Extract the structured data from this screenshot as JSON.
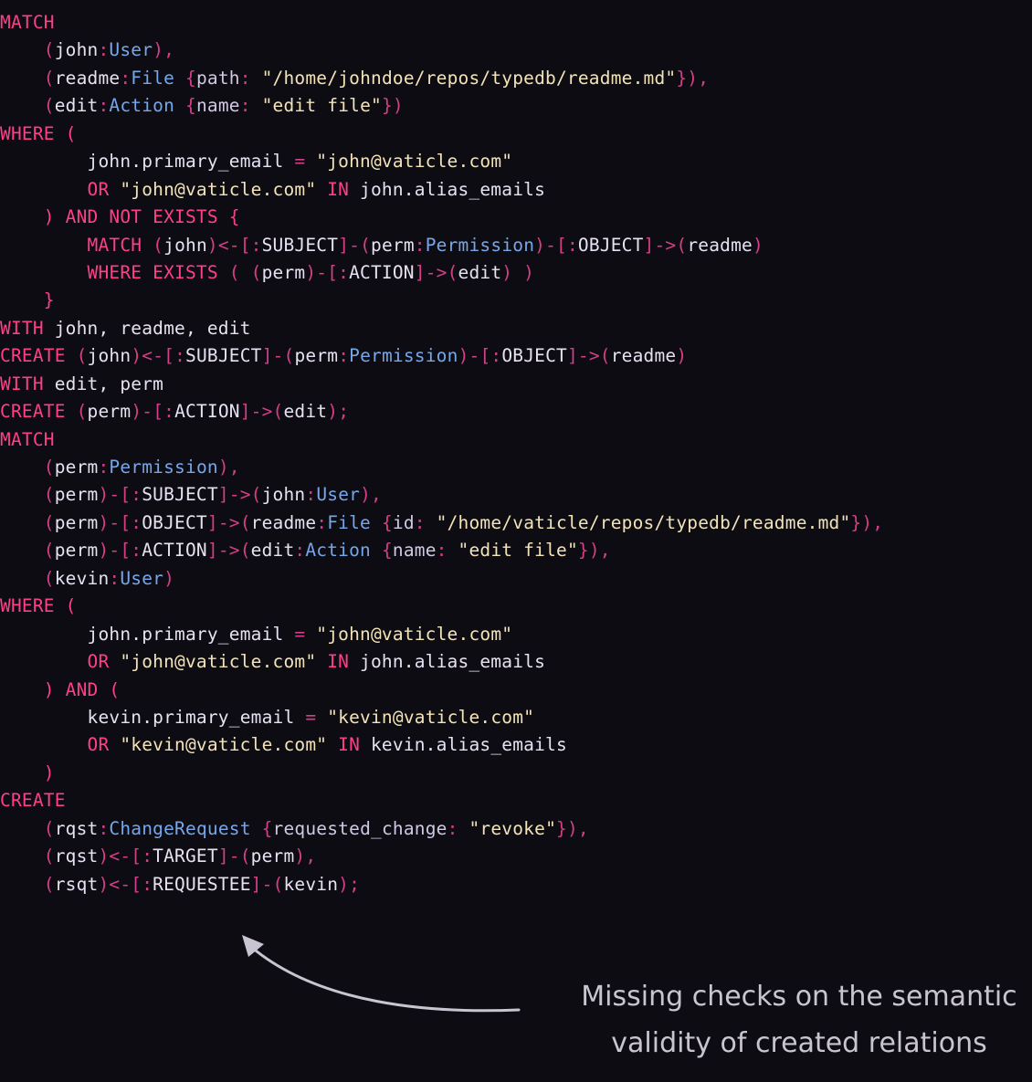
{
  "code_lines": [
    [
      {
        "t": "MATCH",
        "c": "kw"
      }
    ],
    [
      {
        "t": "    (",
        "c": "pu"
      },
      {
        "t": "john",
        "c": "va"
      },
      {
        "t": ":",
        "c": "pu"
      },
      {
        "t": "User",
        "c": "ty"
      },
      {
        "t": "),",
        "c": "pu"
      }
    ],
    [
      {
        "t": "    (",
        "c": "pu"
      },
      {
        "t": "readme",
        "c": "va"
      },
      {
        "t": ":",
        "c": "pu"
      },
      {
        "t": "File",
        "c": "ty"
      },
      {
        "t": " {",
        "c": "pu"
      },
      {
        "t": "path",
        "c": "fl"
      },
      {
        "t": ": ",
        "c": "pu"
      },
      {
        "t": "\"/home/johndoe/repos/typedb/readme.md\"",
        "c": "st"
      },
      {
        "t": "}),",
        "c": "pu"
      }
    ],
    [
      {
        "t": "    (",
        "c": "pu"
      },
      {
        "t": "edit",
        "c": "va"
      },
      {
        "t": ":",
        "c": "pu"
      },
      {
        "t": "Action",
        "c": "ty"
      },
      {
        "t": " {",
        "c": "pu"
      },
      {
        "t": "name",
        "c": "fl"
      },
      {
        "t": ": ",
        "c": "pu"
      },
      {
        "t": "\"edit file\"",
        "c": "st"
      },
      {
        "t": "})",
        "c": "pu"
      }
    ],
    [
      {
        "t": "WHERE (",
        "c": "kw"
      }
    ],
    [
      {
        "t": "        ",
        "c": "va"
      },
      {
        "t": "john.primary_email",
        "c": "va"
      },
      {
        "t": " = ",
        "c": "pu"
      },
      {
        "t": "\"john@vaticle.com\"",
        "c": "st"
      }
    ],
    [
      {
        "t": "        OR ",
        "c": "kw"
      },
      {
        "t": "\"john@vaticle.com\"",
        "c": "st"
      },
      {
        "t": " IN ",
        "c": "kw"
      },
      {
        "t": "john.alias_emails",
        "c": "va"
      }
    ],
    [
      {
        "t": "    ) AND NOT EXISTS {",
        "c": "kw"
      }
    ],
    [
      {
        "t": "        MATCH ",
        "c": "kw"
      },
      {
        "t": "(",
        "c": "pu"
      },
      {
        "t": "john",
        "c": "va"
      },
      {
        "t": ")<-[:",
        "c": "pu"
      },
      {
        "t": "SUBJECT",
        "c": "va"
      },
      {
        "t": "]-(",
        "c": "pu"
      },
      {
        "t": "perm",
        "c": "va"
      },
      {
        "t": ":",
        "c": "pu"
      },
      {
        "t": "Permission",
        "c": "ty"
      },
      {
        "t": ")-[:",
        "c": "pu"
      },
      {
        "t": "OBJECT",
        "c": "va"
      },
      {
        "t": "]->(",
        "c": "pu"
      },
      {
        "t": "readme",
        "c": "va"
      },
      {
        "t": ")",
        "c": "pu"
      }
    ],
    [
      {
        "t": "        WHERE EXISTS ",
        "c": "kw"
      },
      {
        "t": "( (",
        "c": "pu"
      },
      {
        "t": "perm",
        "c": "va"
      },
      {
        "t": ")-[:",
        "c": "pu"
      },
      {
        "t": "ACTION",
        "c": "va"
      },
      {
        "t": "]->(",
        "c": "pu"
      },
      {
        "t": "edit",
        "c": "va"
      },
      {
        "t": ") )",
        "c": "pu"
      }
    ],
    [
      {
        "t": "    }",
        "c": "kw"
      }
    ],
    [
      {
        "t": "WITH ",
        "c": "kw"
      },
      {
        "t": "john, readme, edit",
        "c": "va"
      }
    ],
    [
      {
        "t": "CREATE ",
        "c": "kw"
      },
      {
        "t": "(",
        "c": "pu"
      },
      {
        "t": "john",
        "c": "va"
      },
      {
        "t": ")<-[:",
        "c": "pu"
      },
      {
        "t": "SUBJECT",
        "c": "va"
      },
      {
        "t": "]-(",
        "c": "pu"
      },
      {
        "t": "perm",
        "c": "va"
      },
      {
        "t": ":",
        "c": "pu"
      },
      {
        "t": "Permission",
        "c": "ty"
      },
      {
        "t": ")-[:",
        "c": "pu"
      },
      {
        "t": "OBJECT",
        "c": "va"
      },
      {
        "t": "]->(",
        "c": "pu"
      },
      {
        "t": "readme",
        "c": "va"
      },
      {
        "t": ")",
        "c": "pu"
      }
    ],
    [
      {
        "t": "WITH ",
        "c": "kw"
      },
      {
        "t": "edit, perm",
        "c": "va"
      }
    ],
    [
      {
        "t": "CREATE ",
        "c": "kw"
      },
      {
        "t": "(",
        "c": "pu"
      },
      {
        "t": "perm",
        "c": "va"
      },
      {
        "t": ")-[:",
        "c": "pu"
      },
      {
        "t": "ACTION",
        "c": "va"
      },
      {
        "t": "]->(",
        "c": "pu"
      },
      {
        "t": "edit",
        "c": "va"
      },
      {
        "t": ");",
        "c": "pu"
      }
    ],
    [
      {
        "t": "MATCH",
        "c": "kw"
      }
    ],
    [
      {
        "t": "    (",
        "c": "pu"
      },
      {
        "t": "perm",
        "c": "va"
      },
      {
        "t": ":",
        "c": "pu"
      },
      {
        "t": "Permission",
        "c": "ty"
      },
      {
        "t": "),",
        "c": "pu"
      }
    ],
    [
      {
        "t": "    (",
        "c": "pu"
      },
      {
        "t": "perm",
        "c": "va"
      },
      {
        "t": ")-[:",
        "c": "pu"
      },
      {
        "t": "SUBJECT",
        "c": "va"
      },
      {
        "t": "]->(",
        "c": "pu"
      },
      {
        "t": "john",
        "c": "va"
      },
      {
        "t": ":",
        "c": "pu"
      },
      {
        "t": "User",
        "c": "ty"
      },
      {
        "t": "),",
        "c": "pu"
      }
    ],
    [
      {
        "t": "    (",
        "c": "pu"
      },
      {
        "t": "perm",
        "c": "va"
      },
      {
        "t": ")-[:",
        "c": "pu"
      },
      {
        "t": "OBJECT",
        "c": "va"
      },
      {
        "t": "]->(",
        "c": "pu"
      },
      {
        "t": "readme",
        "c": "va"
      },
      {
        "t": ":",
        "c": "pu"
      },
      {
        "t": "File",
        "c": "ty"
      },
      {
        "t": " {",
        "c": "pu"
      },
      {
        "t": "id",
        "c": "fl"
      },
      {
        "t": ": ",
        "c": "pu"
      },
      {
        "t": "\"/home/vaticle/repos/typedb/readme.md\"",
        "c": "st"
      },
      {
        "t": "}),",
        "c": "pu"
      }
    ],
    [
      {
        "t": "    (",
        "c": "pu"
      },
      {
        "t": "perm",
        "c": "va"
      },
      {
        "t": ")-[:",
        "c": "pu"
      },
      {
        "t": "ACTION",
        "c": "va"
      },
      {
        "t": "]->(",
        "c": "pu"
      },
      {
        "t": "edit",
        "c": "va"
      },
      {
        "t": ":",
        "c": "pu"
      },
      {
        "t": "Action",
        "c": "ty"
      },
      {
        "t": " {",
        "c": "pu"
      },
      {
        "t": "name",
        "c": "fl"
      },
      {
        "t": ": ",
        "c": "pu"
      },
      {
        "t": "\"edit file\"",
        "c": "st"
      },
      {
        "t": "}),",
        "c": "pu"
      }
    ],
    [
      {
        "t": "    (",
        "c": "pu"
      },
      {
        "t": "kevin",
        "c": "va"
      },
      {
        "t": ":",
        "c": "pu"
      },
      {
        "t": "User",
        "c": "ty"
      },
      {
        "t": ")",
        "c": "pu"
      }
    ],
    [
      {
        "t": "WHERE (",
        "c": "kw"
      }
    ],
    [
      {
        "t": "        ",
        "c": "va"
      },
      {
        "t": "john.primary_email",
        "c": "va"
      },
      {
        "t": " = ",
        "c": "pu"
      },
      {
        "t": "\"john@vaticle.com\"",
        "c": "st"
      }
    ],
    [
      {
        "t": "        OR ",
        "c": "kw"
      },
      {
        "t": "\"john@vaticle.com\"",
        "c": "st"
      },
      {
        "t": " IN ",
        "c": "kw"
      },
      {
        "t": "john.alias_emails",
        "c": "va"
      }
    ],
    [
      {
        "t": "    ) AND (",
        "c": "kw"
      }
    ],
    [
      {
        "t": "        ",
        "c": "va"
      },
      {
        "t": "kevin.primary_email",
        "c": "va"
      },
      {
        "t": " = ",
        "c": "pu"
      },
      {
        "t": "\"kevin@vaticle.com\"",
        "c": "st"
      }
    ],
    [
      {
        "t": "        OR ",
        "c": "kw"
      },
      {
        "t": "\"kevin@vaticle.com\"",
        "c": "st"
      },
      {
        "t": " IN ",
        "c": "kw"
      },
      {
        "t": "kevin.alias_emails",
        "c": "va"
      }
    ],
    [
      {
        "t": "    )",
        "c": "kw"
      }
    ],
    [
      {
        "t": "CREATE",
        "c": "kw"
      }
    ],
    [
      {
        "t": "    (",
        "c": "pu"
      },
      {
        "t": "rqst",
        "c": "va"
      },
      {
        "t": ":",
        "c": "pu"
      },
      {
        "t": "ChangeRequest",
        "c": "ty"
      },
      {
        "t": " {",
        "c": "pu"
      },
      {
        "t": "requested_change",
        "c": "fl"
      },
      {
        "t": ": ",
        "c": "pu"
      },
      {
        "t": "\"revoke\"",
        "c": "st"
      },
      {
        "t": "}),",
        "c": "pu"
      }
    ],
    [
      {
        "t": "    (",
        "c": "pu"
      },
      {
        "t": "rqst",
        "c": "va"
      },
      {
        "t": ")<-[:",
        "c": "pu"
      },
      {
        "t": "TARGET",
        "c": "va"
      },
      {
        "t": "]-(",
        "c": "pu"
      },
      {
        "t": "perm",
        "c": "va"
      },
      {
        "t": "),",
        "c": "pu"
      }
    ],
    [
      {
        "t": "    (",
        "c": "pu"
      },
      {
        "t": "rsqt",
        "c": "va"
      },
      {
        "t": ")<-[:",
        "c": "pu"
      },
      {
        "t": "REQUESTEE",
        "c": "va"
      },
      {
        "t": "]-(",
        "c": "pu"
      },
      {
        "t": "kevin",
        "c": "va"
      },
      {
        "t": ");",
        "c": "pu"
      }
    ]
  ],
  "annotation": {
    "line1": "Missing checks on the semantic",
    "line2": "validity of created relations"
  },
  "colors": {
    "background": "#0d0c12",
    "keyword": "#ff3f8b",
    "punctuation": "#d43f87",
    "variable": "#e7e1f2",
    "type": "#76a7ea",
    "string": "#f3e3b8",
    "annotation_text": "#c9c5d0",
    "arrow": "#c9c5d0"
  }
}
